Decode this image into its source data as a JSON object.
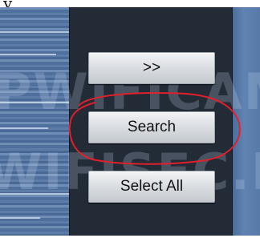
{
  "corner_glyph": "y",
  "buttons": {
    "forward_label": ">>",
    "search_label": "Search",
    "select_all_label": "Select All"
  },
  "watermark": {
    "line1": "PWIFICAM",
    "line2": "WIFISEC.FR"
  },
  "colors": {
    "center_panel": "#222b36",
    "side_panel": "#5d7ca8",
    "button_face": "#d9dde2",
    "highlight": "#e0202a"
  }
}
